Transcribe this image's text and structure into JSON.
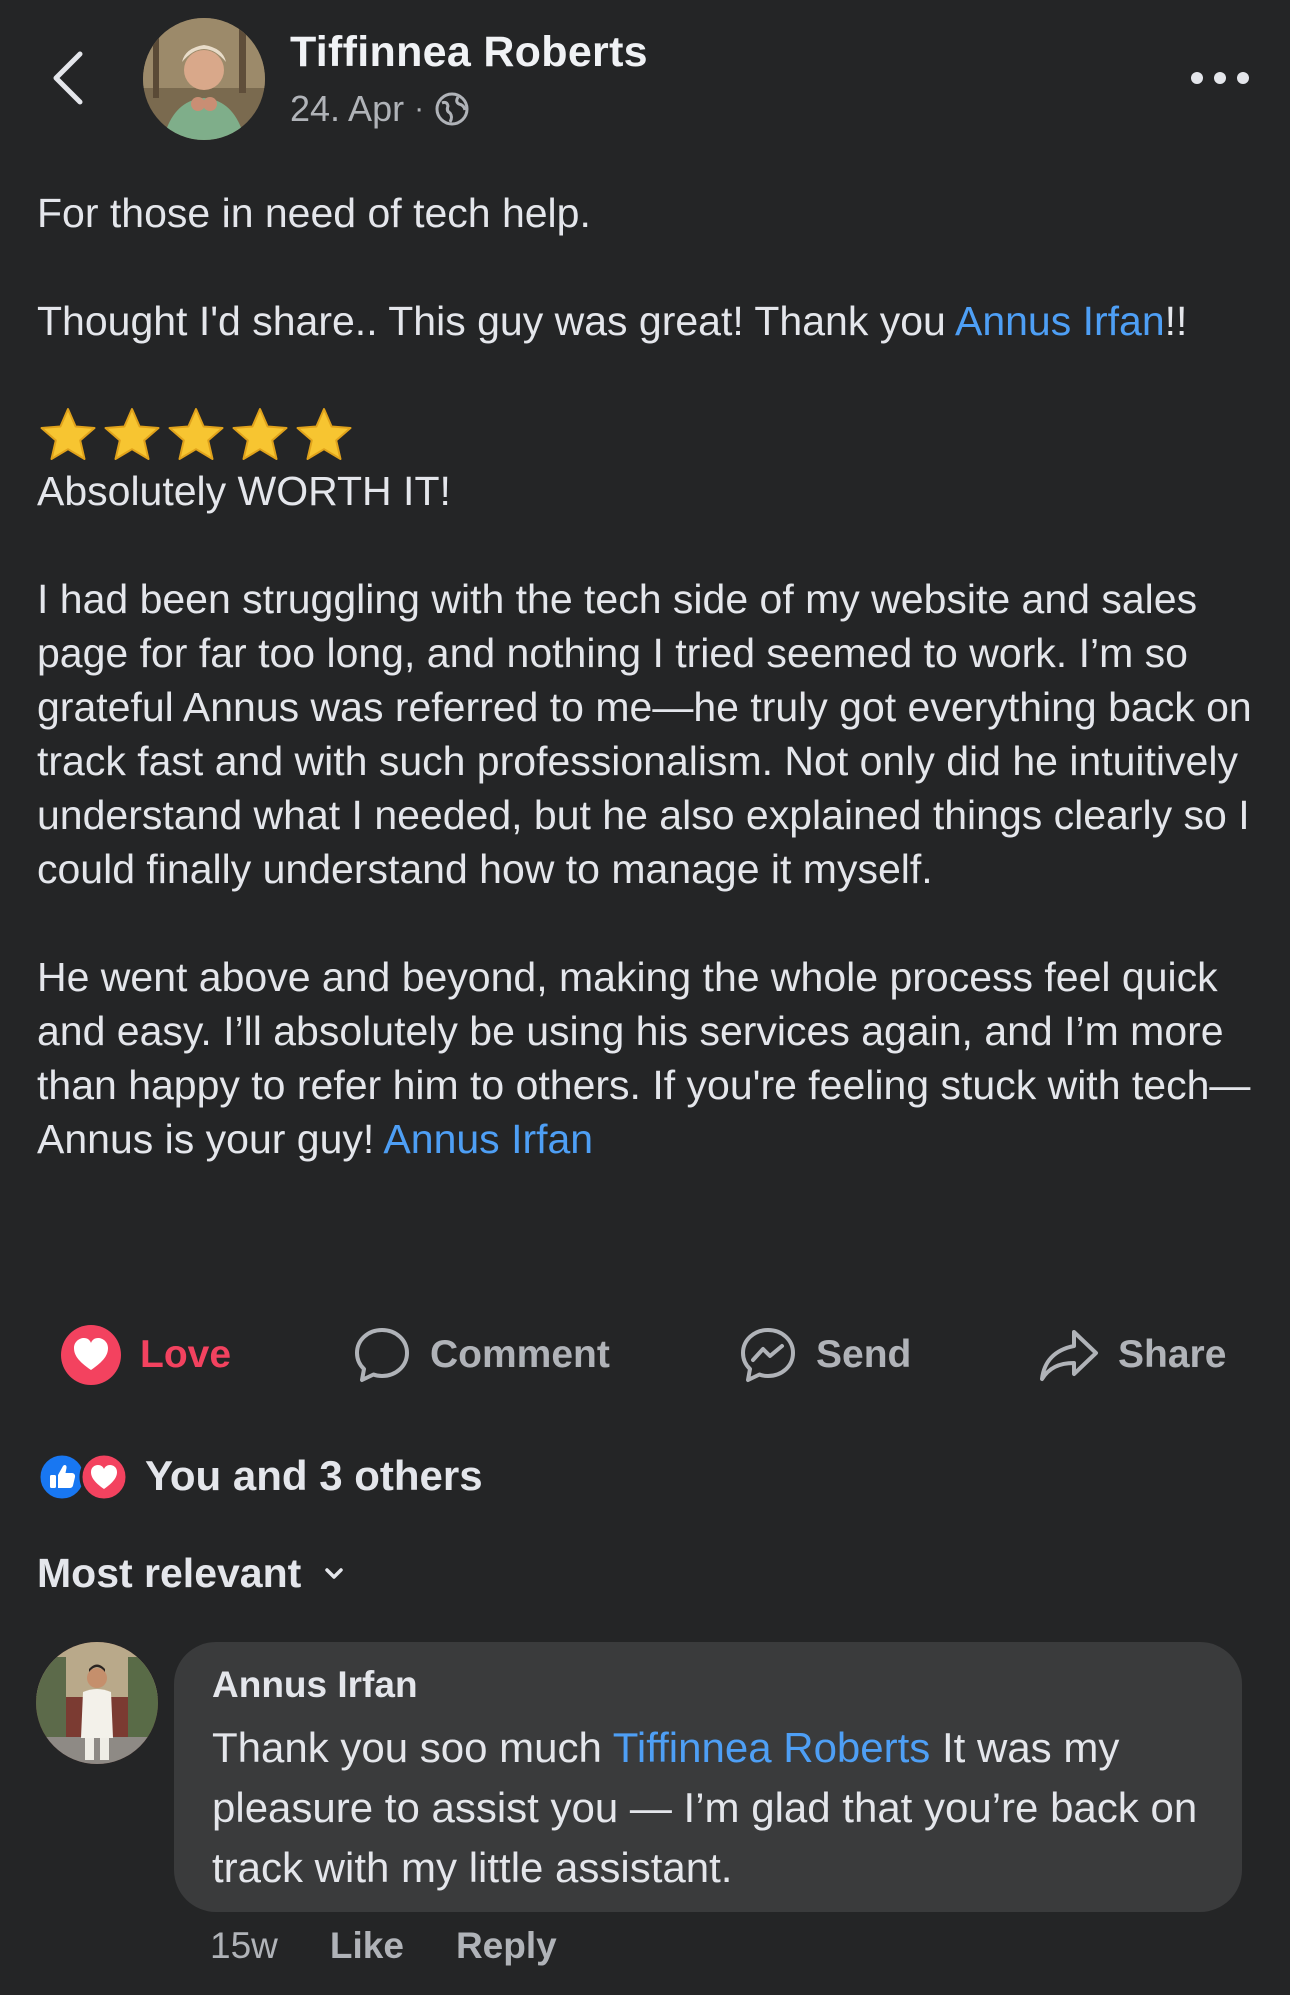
{
  "header": {
    "author_name": "Tiffinnea Roberts",
    "date": "24. Apr",
    "separator": "·",
    "icons": {
      "back": "chevron-left-icon",
      "privacy": "globe-icon",
      "more": "more-horizontal-icon"
    }
  },
  "post": {
    "intro": "For those in need of tech help.",
    "line2_prefix": "Thought I'd share.. This guy was great! Thank you ",
    "mention1": "Annus Irfan",
    "line2_suffix": "!!",
    "rating_stars": 5,
    "headline": "Absolutely WORTH IT!",
    "paragraph1": "I had been struggling with the tech side of my website and sales page for far too long, and nothing I tried seemed to work. I’m so grateful Annus was referred to me—he truly got everything back on track fast and with such professionalism. Not only did he intuitively understand what I needed, but he also explained things clearly so I could finally understand how to manage it myself.",
    "paragraph2": "He went above and beyond, making the whole process feel quick and easy. I’ll absolutely be using his services again, and I’m more than happy to refer him to others. If you're feeling stuck with tech—Annus is your guy! ",
    "mention2": "Annus Irfan"
  },
  "actions": {
    "love": "Love",
    "comment": "Comment",
    "send": "Send",
    "share": "Share"
  },
  "reactions": {
    "summary": "You and 3 others",
    "types": [
      "like",
      "love"
    ]
  },
  "sort": {
    "label": "Most relevant"
  },
  "comment": {
    "author": "Annus Irfan",
    "text_prefix": "Thank you soo much ",
    "mention": "Tiffinnea Roberts",
    "text_suffix": " It was my pleasure to assist you — I’m glad that you’re back on track with my little assistant.",
    "age": "15w",
    "like": "Like",
    "reply": "Reply"
  },
  "colors": {
    "background": "#242526",
    "text": "#e4e6eb",
    "secondary": "#b0b3b8",
    "link": "#4e9ff5",
    "love": "#f3425f",
    "like": "#1877f2",
    "bubble": "#3a3b3c"
  }
}
